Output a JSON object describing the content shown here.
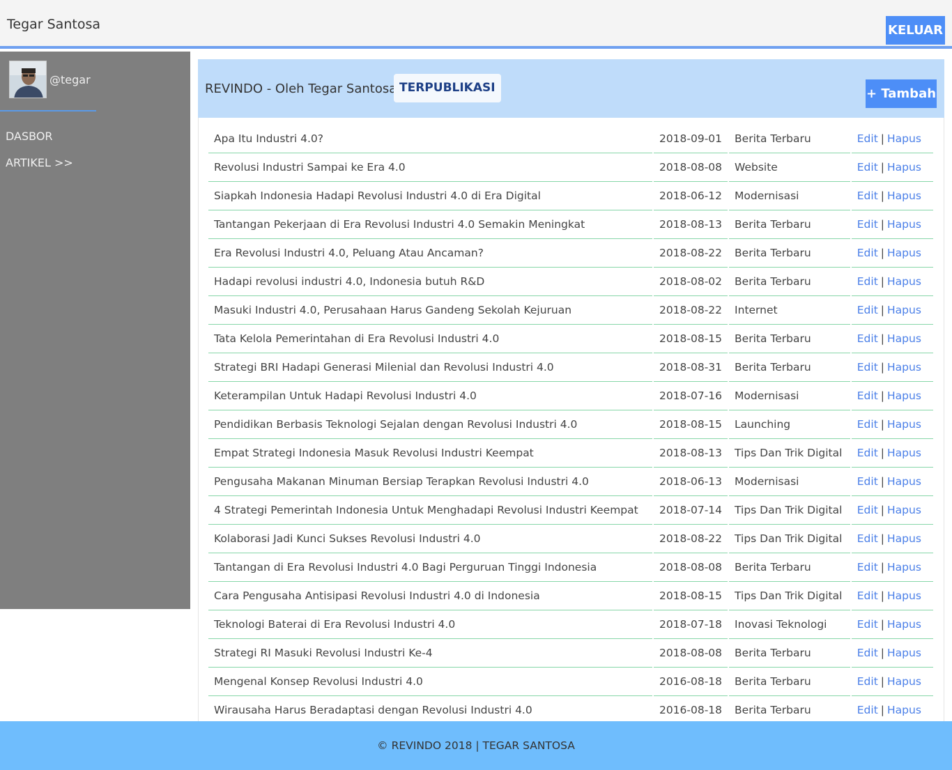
{
  "header": {
    "brand": "Tegar Santosa",
    "logout_label": "KELUAR"
  },
  "sidebar": {
    "username": "@tegar",
    "items": [
      {
        "label": "DASBOR"
      },
      {
        "label": "ARTIKEL >>"
      }
    ]
  },
  "panel": {
    "title": "REVINDO - Oleh Tegar Santosa",
    "status": "TERPUBLIKASI",
    "add_label": "+ Tambah"
  },
  "table": {
    "edit_label": "Edit",
    "delete_label": "Hapus",
    "separator": "|",
    "rows": [
      {
        "title": "Apa Itu Industri 4.0?",
        "date": "2018-09-01",
        "category": "Berita Terbaru"
      },
      {
        "title": "Revolusi Industri Sampai ke Era 4.0",
        "date": "2018-08-08",
        "category": "Website"
      },
      {
        "title": "Siapkah Indonesia Hadapi Revolusi Industri 4.0 di Era Digital",
        "date": "2018-06-12",
        "category": "Modernisasi"
      },
      {
        "title": "Tantangan Pekerjaan di Era Revolusi Industri 4.0 Semakin Meningkat",
        "date": "2018-08-13",
        "category": "Berita Terbaru"
      },
      {
        "title": "Era Revolusi Industri 4.0, Peluang Atau Ancaman?",
        "date": "2018-08-22",
        "category": "Berita Terbaru"
      },
      {
        "title": "Hadapi revolusi industri 4.0, Indonesia butuh R&D",
        "date": "2018-08-02",
        "category": "Berita Terbaru"
      },
      {
        "title": "Masuki Industri 4.0, Perusahaan Harus Gandeng Sekolah Kejuruan",
        "date": "2018-08-22",
        "category": "Internet"
      },
      {
        "title": "Tata Kelola Pemerintahan di Era Revolusi Industri 4.0",
        "date": "2018-08-15",
        "category": "Berita Terbaru"
      },
      {
        "title": "Strategi BRI Hadapi Generasi Milenial dan Revolusi Industri 4.0",
        "date": "2018-08-31",
        "category": "Berita Terbaru"
      },
      {
        "title": "Keterampilan Untuk Hadapi Revolusi Industri 4.0",
        "date": "2018-07-16",
        "category": "Modernisasi"
      },
      {
        "title": "Pendidikan Berbasis Teknologi Sejalan dengan Revolusi Industri 4.0",
        "date": "2018-08-15",
        "category": "Launching"
      },
      {
        "title": "Empat Strategi Indonesia Masuk Revolusi Industri Keempat",
        "date": "2018-08-13",
        "category": "Tips Dan Trik Digital"
      },
      {
        "title": "Pengusaha Makanan Minuman Bersiap Terapkan Revolusi Industri 4.0",
        "date": "2018-06-13",
        "category": "Modernisasi"
      },
      {
        "title": "4 Strategi Pemerintah Indonesia Untuk Menghadapi Revolusi Industri Keempat",
        "date": "2018-07-14",
        "category": "Tips Dan Trik Digital"
      },
      {
        "title": "Kolaborasi Jadi Kunci Sukses Revolusi Industri 4.0",
        "date": "2018-08-22",
        "category": "Tips Dan Trik Digital"
      },
      {
        "title": "Tantangan di Era Revolusi Industri 4.0 Bagi Perguruan Tinggi Indonesia",
        "date": "2018-08-08",
        "category": "Berita Terbaru"
      },
      {
        "title": "Cara Pengusaha Antisipasi Revolusi Industri 4.0 di Indonesia",
        "date": "2018-08-15",
        "category": "Tips Dan Trik Digital"
      },
      {
        "title": "Teknologi Baterai di Era Revolusi Industri 4.0",
        "date": "2018-07-18",
        "category": "Inovasi Teknologi"
      },
      {
        "title": "Strategi RI Masuki Revolusi Industri Ke-4",
        "date": "2018-08-08",
        "category": "Berita Terbaru"
      },
      {
        "title": "Mengenal Konsep Revolusi Industri 4.0",
        "date": "2016-08-18",
        "category": "Berita Terbaru"
      },
      {
        "title": "Wirausaha Harus Beradaptasi dengan Revolusi Industri 4.0",
        "date": "2016-08-18",
        "category": "Berita Terbaru"
      }
    ]
  },
  "footer": {
    "text": "© REVINDO 2018 | TEGAR SANTOSA"
  },
  "colors": {
    "accent": "#4d8ef7",
    "footer": "#6fbdfd",
    "panel_head": "#bfdcfa",
    "sidebar": "#7f7f7f",
    "row_border": "#86d6a8"
  }
}
